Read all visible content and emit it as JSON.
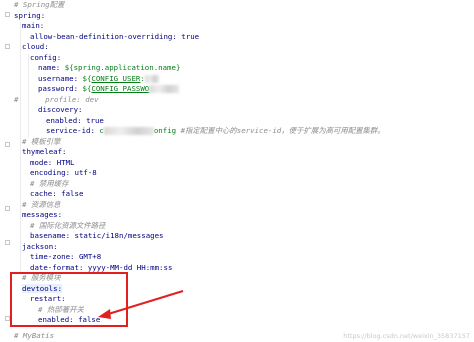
{
  "lines": {
    "l1": "# Spring配置",
    "l2": "spring:",
    "l3": "main:",
    "l4_key": "allow-bean-definition-overriding:",
    "l4_val": "true",
    "l5": "cloud:",
    "l6": "config:",
    "l7_key": "name:",
    "l7_val": "${spring.application.name}",
    "l8_key": "username:",
    "l8_val_pre": "${",
    "l8_val_link": "CONFIG_USER",
    "l8_val_post": ":",
    "l9_key": "password:",
    "l9_val_pre": "${",
    "l9_val_link": "CONFIG_PASSWO",
    "l10": "#      profile: dev",
    "l11": "discovery:",
    "l12_key": "enabled:",
    "l12_val": "true",
    "l13_key": "service-id:",
    "l13_val_pre": "c",
    "l13_val_post": "onfig",
    "l13_cmt": "#指定配置中心的service-id，便于扩展为高可用配置集群。",
    "l14": "# 模板引擎",
    "l15": "thymeleaf:",
    "l16_key": "mode:",
    "l16_val": "HTML",
    "l17_key": "encoding:",
    "l17_val": "utf-8",
    "l18": "# 禁用缓存",
    "l19_key": "cache:",
    "l19_val": "false",
    "l20": "# 资源信息",
    "l21": "messages:",
    "l22": "# 国际化资源文件路径",
    "l23_key": "basename:",
    "l23_val": "static/i18n/messages",
    "l24": "jackson:",
    "l25_key": "time-zone:",
    "l25_val": "GMT+8",
    "l26_key": "date-format:",
    "l26_val": "yyyy-MM-dd HH:mm:ss",
    "l27": "# 服务模块",
    "l28": "devtools:",
    "l29": "restart:",
    "l30": "# 热部署开关",
    "l31_key": "enabled:",
    "l31_val": "false",
    "l32": "# MyBatis"
  },
  "watermark": "https://blog.csdn.net/weixin_35837157",
  "colors": {
    "key": "#000080",
    "value": "#067d17",
    "comment": "#8c8c8c",
    "highlight": "#e02020"
  }
}
